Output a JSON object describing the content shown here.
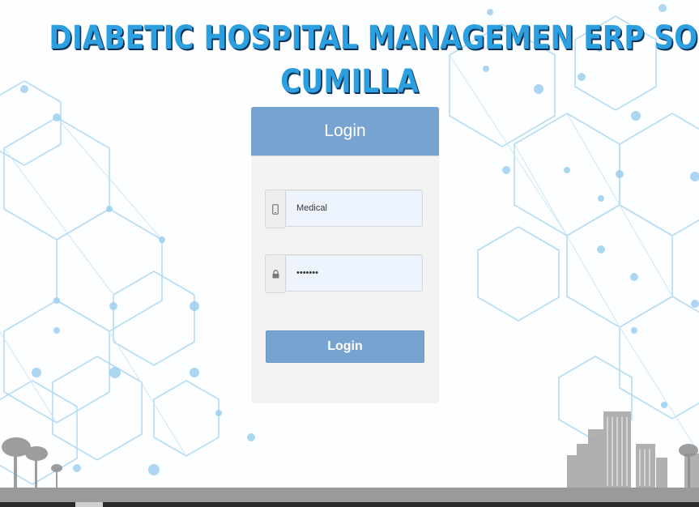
{
  "header": {
    "title_line1": "DIABETIC HOSPITAL MANAGEMEN ERP SOFTWARE",
    "title_line2": "CUMILLA"
  },
  "login": {
    "heading": "Login",
    "username_value": "Medical",
    "password_value": "•••••••",
    "submit_label": "Login"
  },
  "icons": {
    "username": "mobile-phone-icon",
    "password": "lock-icon"
  },
  "colors": {
    "title": "#2b9fdf",
    "title_shadow": "#0c2f55",
    "panel_header": "#76a3cf",
    "button": "#76a3cf",
    "panel_body": "#f3f3f3",
    "pattern": "#9fd0ee",
    "footer": "#9a9a9a"
  }
}
